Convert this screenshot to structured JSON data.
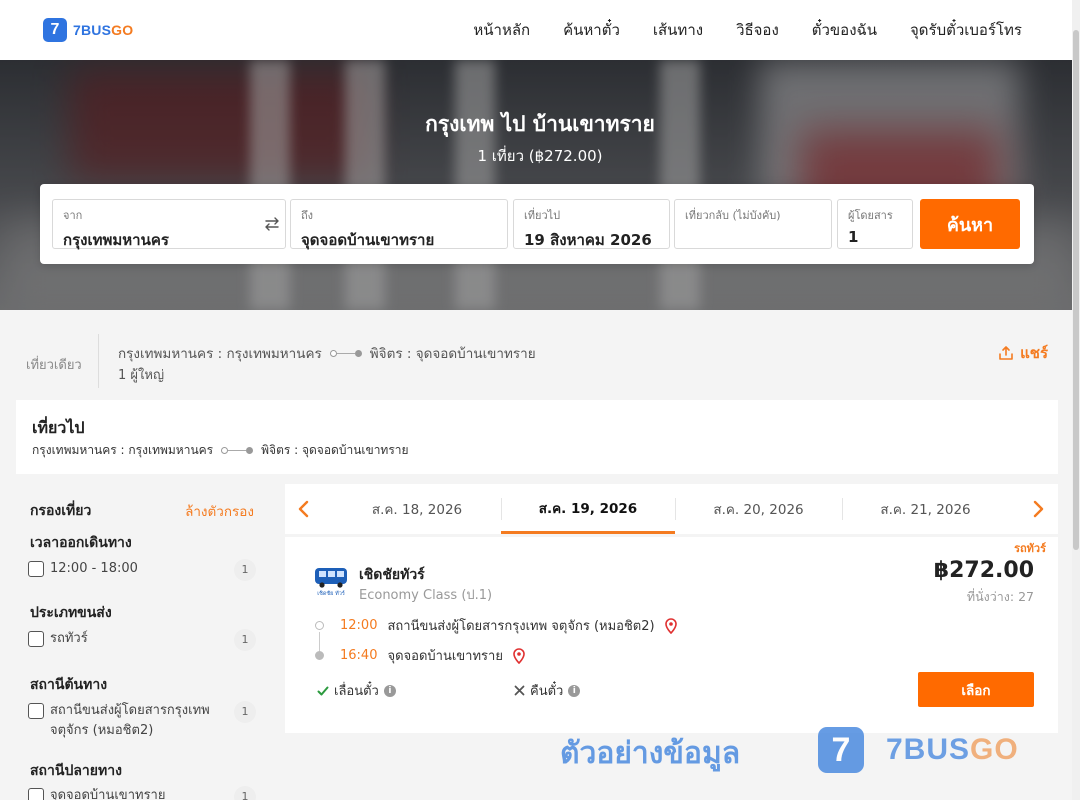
{
  "header": {
    "logo_mark": "7",
    "logo_brand": "7BUS",
    "logo_brand_go": "GO",
    "nav": [
      "หน้าหลัก",
      "ค้นหาตั๋ว",
      "เส้นทาง",
      "วิธีจอง",
      "ตั๋วของฉัน",
      "จุดรับตั๋วเบอร์โทร"
    ]
  },
  "hero": {
    "title": "กรุงเทพ ไป บ้านเขาทราย",
    "subtitle": "1 เที่ยว (฿272.00)"
  },
  "search": {
    "from_label": "จาก",
    "from_value": "กรุงเทพมหานคร",
    "to_label": "ถึง",
    "to_value": "จุดจอดบ้านเขาทราย",
    "depart_label": "เที่ยวไป",
    "depart_value": "19 สิงหาคม 2026",
    "return_label": "เที่ยวกลับ (ไม่บังคับ)",
    "return_value": "",
    "pax_label": "ผู้โดยสาร",
    "pax_value": "1",
    "button": "ค้นหา"
  },
  "summary": {
    "trip_type": "เที่ยวเดียว",
    "origin": "กรุงเทพมหานคร : กรุงเทพมหานคร",
    "destination": "พิจิตร : จุดจอดบ้านเขาทราย",
    "passengers": "1 ผู้ใหญ่",
    "share": "แชร์"
  },
  "outbound": {
    "title": "เที่ยวไป",
    "origin": "กรุงเทพมหานคร : กรุงเทพมหานคร",
    "destination": "พิจิตร : จุดจอดบ้านเขาทราย"
  },
  "filters": {
    "title": "กรองเที่ยว",
    "clear": "ล้างตัวกรอง",
    "sections": [
      {
        "heading": "เวลาออกเดินทาง",
        "options": [
          {
            "label": "12:00 - 18:00",
            "count": "1"
          }
        ]
      },
      {
        "heading": "ประเภทขนส่ง",
        "options": [
          {
            "label": "รถทัวร์",
            "count": "1"
          }
        ]
      },
      {
        "heading": "สถานีต้นทาง",
        "options": [
          {
            "label": "สถานีขนส่งผู้โดยสารกรุงเทพ จตุจักร (หมอชิต2)",
            "count": "1"
          }
        ]
      },
      {
        "heading": "สถานีปลายทาง",
        "options": [
          {
            "label": "จุดจอดบ้านเขาทราย",
            "count": "1"
          }
        ]
      }
    ]
  },
  "dates": {
    "tabs": [
      "ส.ค. 18, 2026",
      "ส.ค. 19, 2026",
      "ส.ค. 20, 2026",
      "ส.ค. 21, 2026"
    ],
    "active_index": 1
  },
  "result": {
    "ribbon": "รถทัวร์",
    "operator": "เชิดชัยทัวร์",
    "logo_caption": "เชิดชัย ทัวร์",
    "class": "Economy Class (ป.1)",
    "price": "฿272.00",
    "seats": "ที่นั่งว่าง: 27",
    "depart_time": "12:00",
    "depart_station": "สถานีขนส่งผู้โดยสารกรุงเทพ จตุจักร (หมอชิต2)",
    "arrive_time": "16:40",
    "arrive_station": "จุดจอดบ้านเขาทราย",
    "reschedule": "เลื่อนตั๋ว",
    "refund": "คืนตั๋ว",
    "select": "เลือก"
  },
  "watermark": {
    "text": "ตัวอย่างข้อมูล",
    "mark": "7",
    "brand": "7BUS",
    "brand_go": "GO"
  },
  "colors": {
    "accent": "#ff6a00",
    "brand_blue": "#2f74e0",
    "orange_text": "#f47b20"
  }
}
